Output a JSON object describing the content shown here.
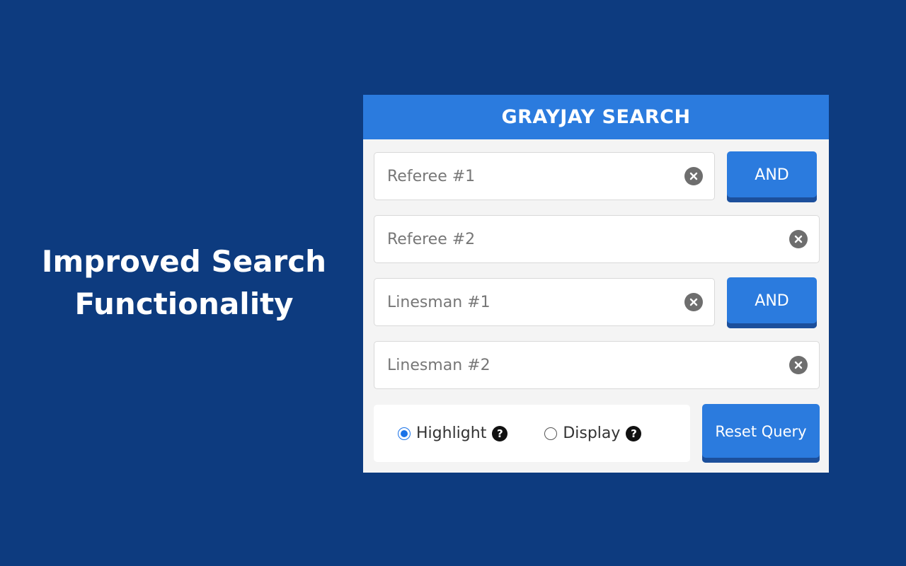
{
  "promo": {
    "line1": "Improved Search",
    "line2": "Functionality"
  },
  "panel": {
    "title": "GRAYJAY SEARCH",
    "fields": [
      {
        "placeholder": "Referee #1",
        "value": ""
      },
      {
        "placeholder": "Referee #2",
        "value": ""
      },
      {
        "placeholder": "Linesman #1",
        "value": ""
      },
      {
        "placeholder": "Linesman #2",
        "value": ""
      }
    ],
    "operators": [
      "AND",
      "AND"
    ],
    "options": {
      "highlight_label": "Highlight",
      "display_label": "Display",
      "selected": "Highlight"
    },
    "reset_label": "Reset Query"
  },
  "colors": {
    "background": "#0d3b7f",
    "accent": "#2b7bde",
    "accent_shadow": "#1c4f9b",
    "radio_selected": "#1a73e8"
  },
  "icons": [
    "clear-circle-x",
    "question-circle"
  ]
}
